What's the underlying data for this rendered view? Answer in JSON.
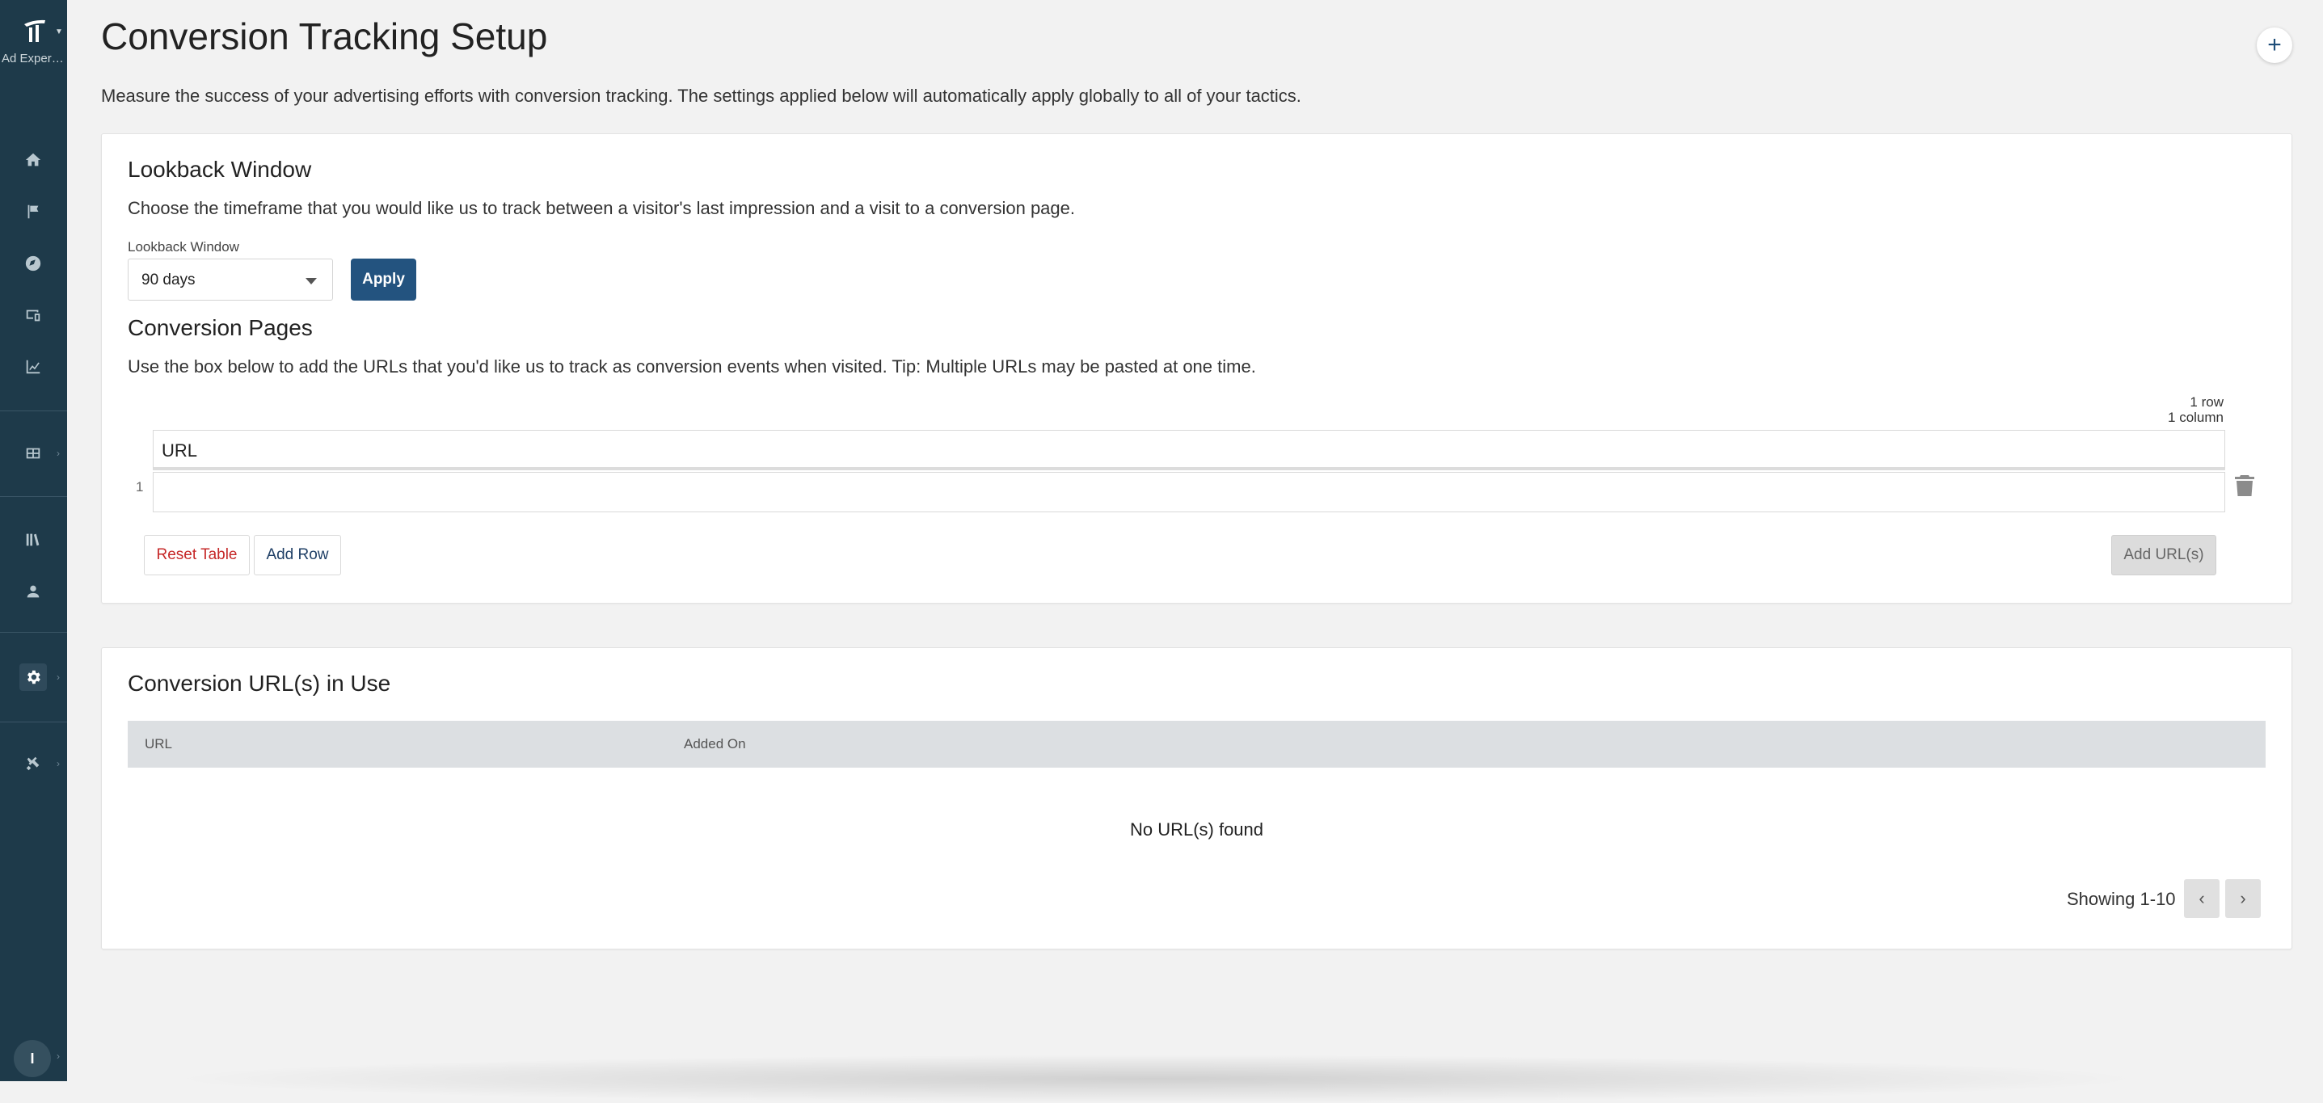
{
  "sidebar": {
    "brand_name": "Ad Experienc...",
    "nav_icons": [
      "home-icon",
      "flag-icon",
      "compass-icon",
      "devices-icon",
      "chart-line-icon",
      "table-icon",
      "library-icon",
      "user-badge-icon",
      "gear-icon",
      "tools-icon"
    ],
    "avatar_initial": "I"
  },
  "page": {
    "title": "Conversion Tracking Setup",
    "description": "Measure the success of your advertising efforts with conversion tracking. The settings applied below will automatically apply globally to all of your tactics.",
    "plus_button": "+"
  },
  "lookback": {
    "title": "Lookback Window",
    "description": "Choose the timeframe that you would like us to track between a visitor's last impression and a visit to a conversion page.",
    "field_label": "Lookback Window",
    "selected_value": "90 days",
    "apply_label": "Apply"
  },
  "conversion_pages": {
    "title": "Conversion Pages",
    "description": "Use the box below to add the URLs that you'd like us to track as conversion events when visited. Tip: Multiple URLs may be pasted at one time.",
    "row_count": "1 row",
    "column_count": "1 column",
    "column_header": "URL",
    "row_number": "1",
    "reset_label": "Reset Table",
    "add_row_label": "Add Row",
    "add_urls_label": "Add URL(s)"
  },
  "in_use": {
    "title": "Conversion URL(s) in Use",
    "columns": [
      "URL",
      "Added On"
    ],
    "empty_message": "No URL(s) found",
    "showing": "Showing 1-10"
  },
  "colors": {
    "sidebar_bg": "#1e3a4a",
    "primary": "#23537f",
    "danger": "#c62828"
  }
}
